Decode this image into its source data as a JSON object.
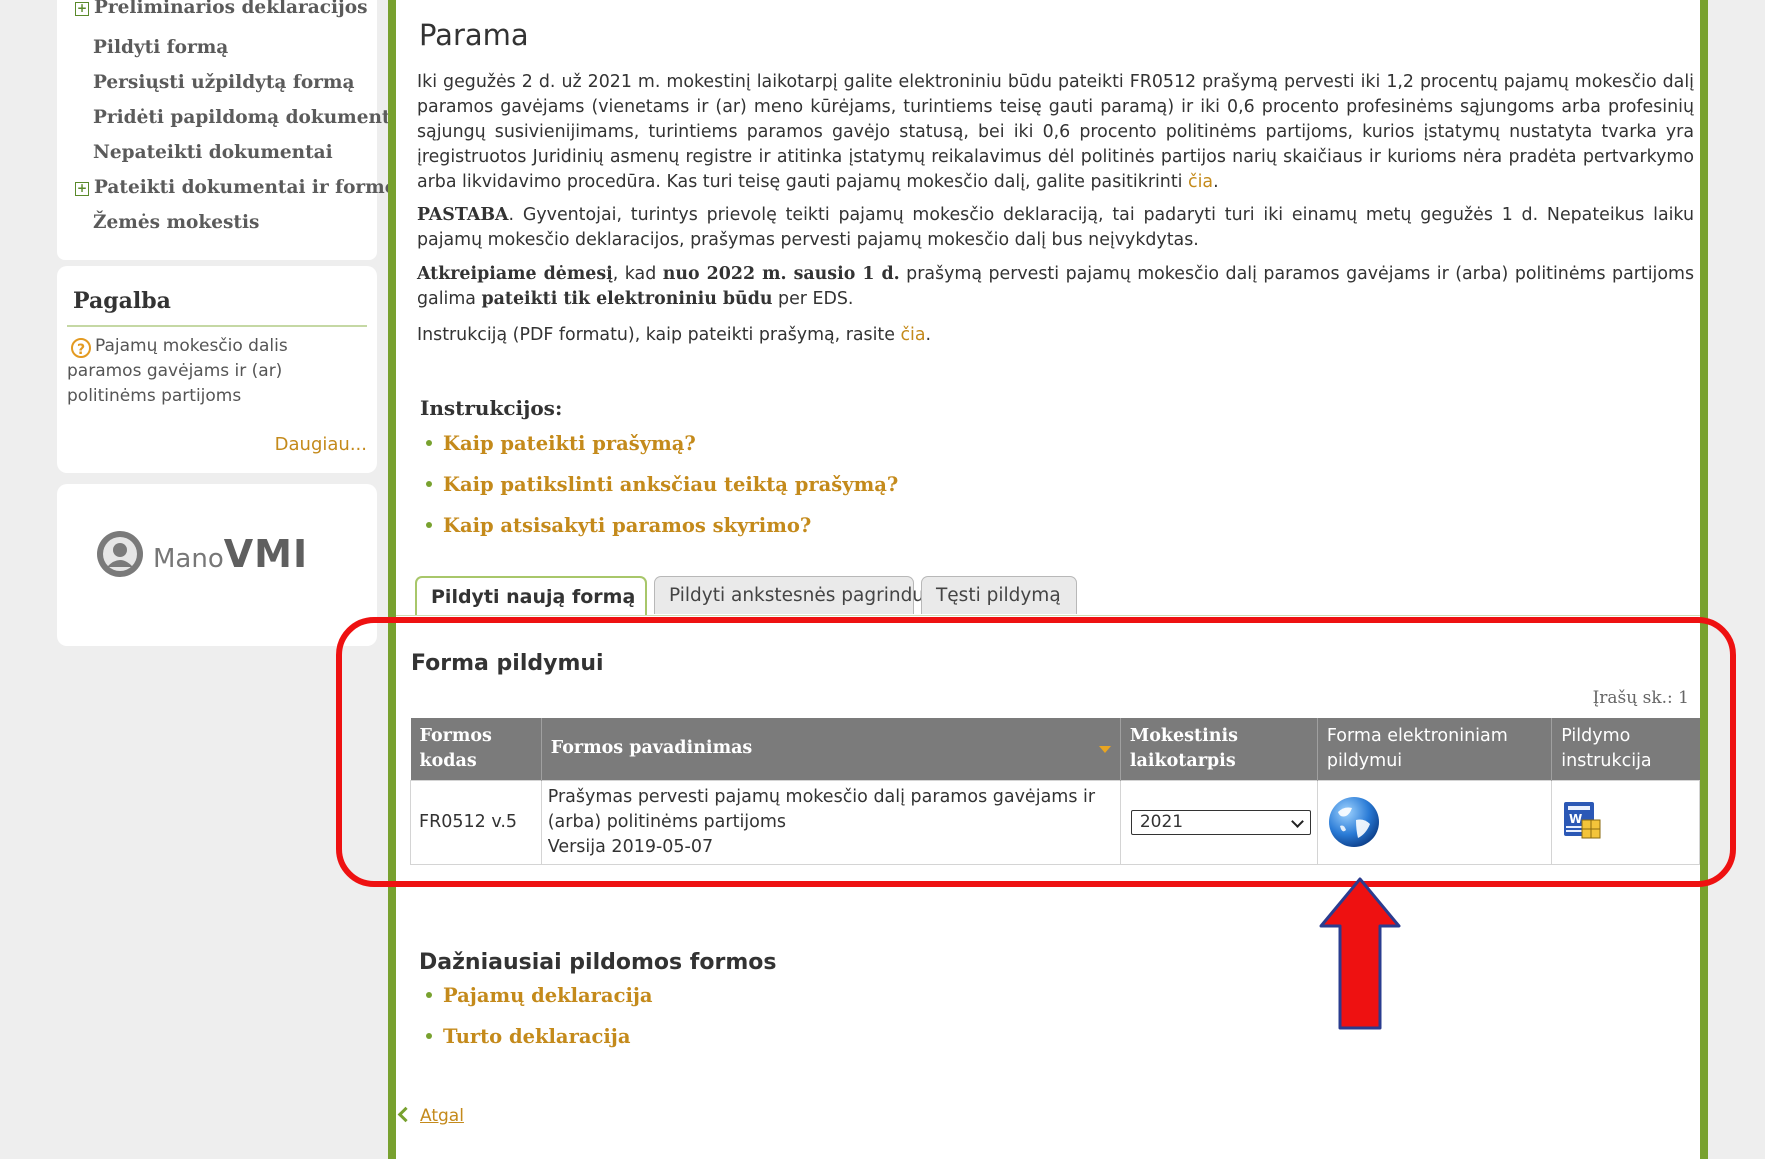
{
  "sidebar": {
    "menu": [
      {
        "label": "Preliminarios deklaracijos",
        "expandable": true
      },
      {
        "label": "Pildyti formą",
        "expandable": false
      },
      {
        "label": "Persiųsti užpildytą formą",
        "expandable": false
      },
      {
        "label": "Pridėti papildomą dokumentą",
        "expandable": false
      },
      {
        "label": "Nepateikti dokumentai",
        "expandable": false
      },
      {
        "label": "Pateikti dokumentai ir formos",
        "expandable": true
      },
      {
        "label": "Žemės mokestis",
        "expandable": false
      }
    ],
    "help": {
      "title": "Pagalba",
      "icon": "question-icon",
      "text": "Pajamų mokesčio dalis paramos gavėjams ir (ar) politinėms partijoms",
      "more": "Daugiau..."
    },
    "logo": {
      "prefix": "Mano",
      "brand": "VMI"
    }
  },
  "main": {
    "title": "Parama",
    "p1": {
      "text": "Iki gegužės 2 d. už 2021 m. mokestinį laikotarpį galite elektroniniu būdu pateikti FR0512 prašymą pervesti iki 1,2 procentų pajamų mokesčio dalį paramos gavėjams (vienetams ir (ar) meno kūrėjams, turintiems teisę gauti paramą) ir iki 0,6 procento profesinėms sąjungoms arba profesinių sąjungų susivienijimams, turintiems paramos gavėjo statusą, bei iki 0,6 procento politinėms partijoms, kurios įstatymų nustatyta tvarka yra įregistruotos Juridinių asmenų registre ir atitinka įstatymų reikalavimus dėl politinės partijos narių skaičiaus ir kurioms nėra pradėta pertvarkymo arba likvidavimo procedūra. Kas turi teisę gauti pajamų mokesčio dalį, galite pasitikrinti ",
      "link": "čia",
      "end": "."
    },
    "p2": {
      "bold": "PASTABA",
      "text": ". Gyventojai, turintys prievolę teikti pajamų mokesčio deklaraciją, tai padaryti turi iki einamų metų gegužės 1 d. Nepateikus laiku pajamų mokesčio deklaracijos, prašymas pervesti pajamų mokesčio dalį bus neįvykdytas."
    },
    "p3": {
      "bold1": "Atkreipiame dėmesį",
      "t1": ", kad ",
      "bold2": "nuo 2022 m. sausio 1 d.",
      "t2": " prašymą pervesti pajamų mokesčio dalį paramos gavėjams ir (arba) politinėms partijoms galima ",
      "bold3": "pateikti tik elektroniniu būdu",
      "t3": " per EDS."
    },
    "p4": {
      "text": "Instrukciją (PDF formatu), kaip pateikti prašymą, rasite ",
      "link": "čia",
      "end": "."
    },
    "instructions_title": "Instrukcijos:",
    "instructions": [
      "Kaip pateikti prašymą?",
      "Kaip patikslinti anksčiau teiktą prašymą?",
      "Kaip atsisakyti paramos skyrimo?"
    ],
    "tabs": [
      "Pildyti naują formą",
      "Pildyti ankstesnės pagrindu",
      "Tęsti pildymą"
    ],
    "active_tab": 0,
    "form_section_title": "Forma pildymui",
    "record_count": "Įrašų sk.: 1",
    "table": {
      "headers": [
        "Formos kodas",
        "Formos pavadinimas",
        "Mokestinis laikotarpis",
        "Forma elektroniniam pildymui",
        "Pildymo instrukcija"
      ],
      "rows": [
        {
          "code": "FR0512 v.5",
          "name": "Prašymas pervesti pajamų mokesčio dalį paramos gavėjams ir (arba) politinėms partijoms",
          "version": "Versija 2019-05-07",
          "period": "2021",
          "fill_icon": "globe-icon",
          "instruction_icon": "word-document-icon"
        }
      ]
    },
    "frequent_title": "Dažniausiai pildomos formos",
    "frequent": [
      "Pajamų deklaracija",
      "Turto deklaracija"
    ],
    "back": "Atgal"
  },
  "annotation": {
    "highlight_color": "#ee1111",
    "arrow_color": "#ee1111"
  }
}
